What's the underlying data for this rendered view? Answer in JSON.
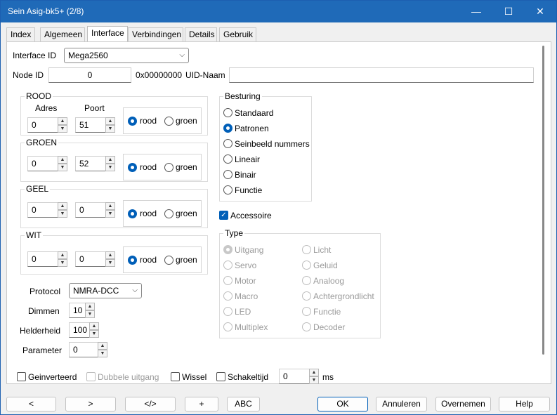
{
  "window": {
    "title": "Sein Asig-bk5+ (2/8)"
  },
  "titlebar": {
    "minimize": "—",
    "maximize": "☐",
    "close": "✕"
  },
  "tabs": [
    "Index",
    "Algemeen",
    "Interface",
    "Verbindingen",
    "Details",
    "Gebruik"
  ],
  "active_tab": "Interface",
  "interface": {
    "interface_id_label": "Interface ID",
    "interface_id_value": "Mega2560",
    "node_id_label": "Node ID",
    "node_id_value": "0",
    "node_hex": "0x00000000",
    "uid_label": "UID-Naam",
    "uid_value": ""
  },
  "groups": [
    {
      "title": "ROOD",
      "adres_label": "Adres",
      "poort_label": "Poort",
      "adres": "0",
      "poort": "51",
      "opt1": "rood",
      "opt2": "groen",
      "selected": "rood"
    },
    {
      "title": "GROEN",
      "adres": "0",
      "poort": "52",
      "opt1": "rood",
      "opt2": "groen",
      "selected": "rood"
    },
    {
      "title": "GEEL",
      "adres": "0",
      "poort": "0",
      "opt1": "rood",
      "opt2": "groen",
      "selected": "rood"
    },
    {
      "title": "WIT",
      "adres": "0",
      "poort": "0",
      "opt1": "rood",
      "opt2": "groen",
      "selected": "rood"
    }
  ],
  "protocol": {
    "label": "Protocol",
    "value": "NMRA-DCC"
  },
  "dimmen": {
    "label": "Dimmen",
    "value": "10"
  },
  "helderheid": {
    "label": "Helderheid",
    "value": "100"
  },
  "parameter": {
    "label": "Parameter",
    "value": "0"
  },
  "besturing": {
    "title": "Besturing",
    "options": [
      "Standaard",
      "Patronen",
      "Seinbeeld nummers",
      "Lineair",
      "Binair",
      "Functie"
    ],
    "selected": "Patronen"
  },
  "accessoire": {
    "label": "Accessoire",
    "checked": true
  },
  "type": {
    "title": "Type",
    "left": [
      "Uitgang",
      "Servo",
      "Motor",
      "Macro",
      "LED",
      "Multiplex"
    ],
    "right": [
      "Licht",
      "Geluid",
      "Analoog",
      "Achtergrondlicht",
      "Functie",
      "Decoder"
    ],
    "selected": "Uitgang"
  },
  "bottom_options": {
    "geinverteerd": "Geinverteerd",
    "dubbele": "Dubbele uitgang",
    "wissel": "Wissel",
    "schakeltijd": "Schakeltijd",
    "schakeltijd_value": "0",
    "ms": "ms"
  },
  "buttons": {
    "prev": "<",
    "next": ">",
    "code": "</>",
    "plus": "+",
    "abc": "ABC",
    "ok": "OK",
    "annuleren": "Annuleren",
    "overnemen": "Overnemen",
    "help": "Help"
  },
  "colors": {
    "titlebar": "#1f6ab8",
    "accent": "#005fb8"
  }
}
